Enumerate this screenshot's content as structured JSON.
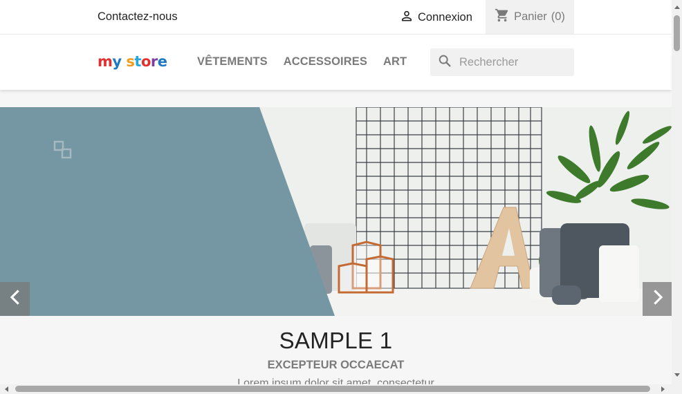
{
  "topbar": {
    "contact_label": "Contactez-nous",
    "login_label": "Connexion",
    "login_icon": "user-icon",
    "cart_label": "Panier",
    "cart_count": "(0)",
    "cart_icon": "shopping-cart-icon"
  },
  "header": {
    "logo_text": [
      "m",
      "y",
      " ",
      "s",
      "t",
      "o",
      "r",
      "e"
    ],
    "nav": [
      {
        "label": "VÊTEMENTS"
      },
      {
        "label": "ACCESSOIRES"
      },
      {
        "label": "ART"
      }
    ],
    "search": {
      "placeholder": "Rechercher",
      "icon": "search-icon"
    }
  },
  "slider": {
    "prev_icon": "chevron-left-icon",
    "next_icon": "chevron-right-icon",
    "caption_title": "SAMPLE 1",
    "caption_subtitle": "EXCEPTEUR OCCAECAT",
    "caption_text": "Lorem ipsum dolor sit amet, consectetur"
  },
  "colors": {
    "slide_panel": "#7596a3",
    "page_bg": "#f6f6f6",
    "text_dark": "#232323",
    "text_muted": "#7a7a7a"
  }
}
